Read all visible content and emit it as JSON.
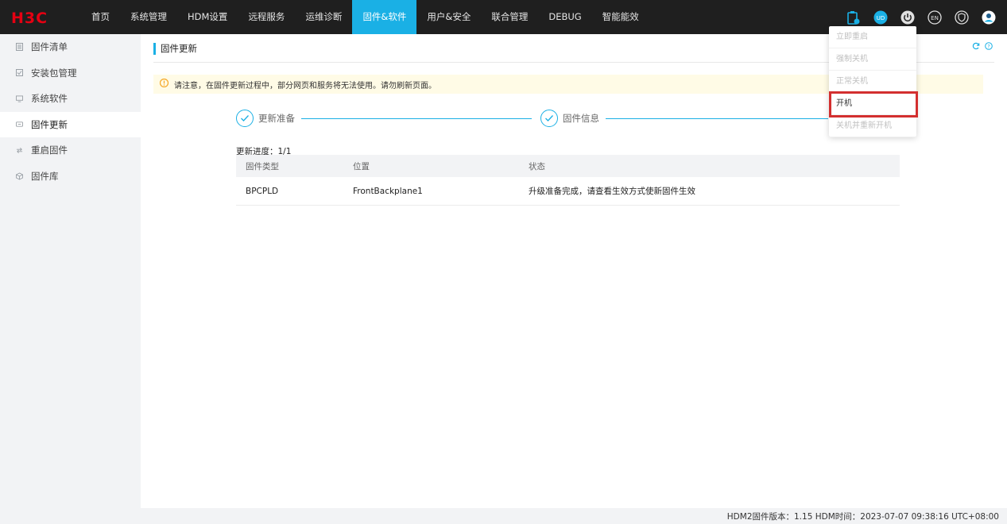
{
  "brand": {
    "logo_text": "H3C",
    "logo_color": "#e60012"
  },
  "nav": {
    "items": [
      {
        "label": "首页"
      },
      {
        "label": "系统管理"
      },
      {
        "label": "HDM设置"
      },
      {
        "label": "远程服务"
      },
      {
        "label": "运维诊断"
      },
      {
        "label": "固件&软件"
      },
      {
        "label": "用户&安全"
      },
      {
        "label": "联合管理"
      },
      {
        "label": "DEBUG"
      },
      {
        "label": "智能能效"
      }
    ],
    "active_index": 5,
    "accent": "#1ab0e5"
  },
  "top_icons": {
    "clipboard_icon": "clipboard-icon",
    "user_badge": "UD",
    "power_icon": "power-icon",
    "lang": "EN",
    "shield_icon": "shield-icon",
    "avatar_icon": "user-avatar-icon"
  },
  "sidebar": {
    "items": [
      {
        "label": "固件清单",
        "icon": "list-icon"
      },
      {
        "label": "安装包管理",
        "icon": "package-icon"
      },
      {
        "label": "系统软件",
        "icon": "monitor-icon"
      },
      {
        "label": "固件更新",
        "icon": "update-icon"
      },
      {
        "label": "重启固件",
        "icon": "restart-icon"
      },
      {
        "label": "固件库",
        "icon": "library-icon"
      }
    ],
    "active_index": 3
  },
  "main": {
    "title": "固件更新",
    "notice": "请注意，在固件更新过程中，部分网页和服务将无法使用。请勿刷新页面。",
    "steps": [
      {
        "label": "更新准备"
      },
      {
        "label": "固件信息"
      }
    ],
    "progress": "更新进度：1/1",
    "table": {
      "headers": [
        "固件类型",
        "位置",
        "状态"
      ],
      "rows": [
        [
          "BPCPLD",
          "FrontBackplane1",
          "升级准备完成，请查看生效方式使新固件生效"
        ]
      ]
    }
  },
  "power_menu": {
    "items": [
      {
        "label": "立即重启",
        "enabled": false
      },
      {
        "label": "强制关机",
        "enabled": false
      },
      {
        "label": "正常关机",
        "enabled": false
      },
      {
        "label": "开机",
        "enabled": true
      },
      {
        "label": "关机并重新开机",
        "enabled": false
      }
    ],
    "highlighted_index": 3,
    "highlight_color": "#d32f2f"
  },
  "footer": {
    "text": "HDM2固件版本：1.15   HDM时间：2023-07-07 09:38:16 UTC+08:00"
  }
}
